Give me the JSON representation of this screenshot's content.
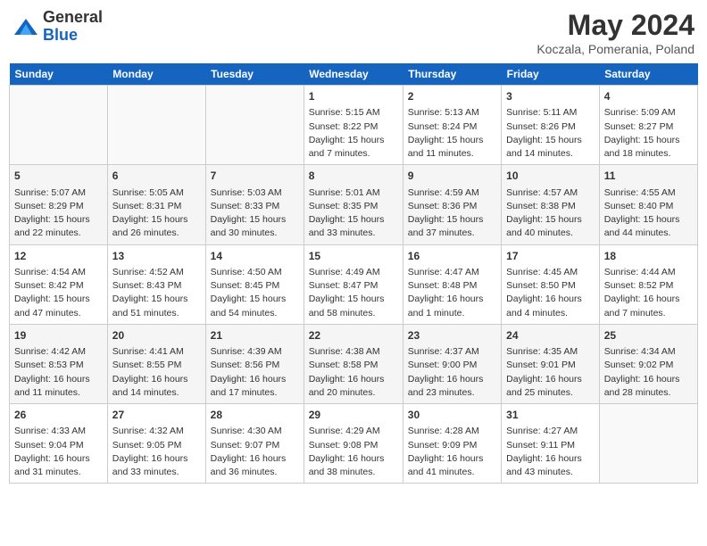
{
  "header": {
    "logo_general": "General",
    "logo_blue": "Blue",
    "month_title": "May 2024",
    "location": "Koczala, Pomerania, Poland"
  },
  "days_of_week": [
    "Sunday",
    "Monday",
    "Tuesday",
    "Wednesday",
    "Thursday",
    "Friday",
    "Saturday"
  ],
  "weeks": [
    [
      {
        "num": "",
        "content": ""
      },
      {
        "num": "",
        "content": ""
      },
      {
        "num": "",
        "content": ""
      },
      {
        "num": "1",
        "content": "Sunrise: 5:15 AM\nSunset: 8:22 PM\nDaylight: 15 hours\nand 7 minutes."
      },
      {
        "num": "2",
        "content": "Sunrise: 5:13 AM\nSunset: 8:24 PM\nDaylight: 15 hours\nand 11 minutes."
      },
      {
        "num": "3",
        "content": "Sunrise: 5:11 AM\nSunset: 8:26 PM\nDaylight: 15 hours\nand 14 minutes."
      },
      {
        "num": "4",
        "content": "Sunrise: 5:09 AM\nSunset: 8:27 PM\nDaylight: 15 hours\nand 18 minutes."
      }
    ],
    [
      {
        "num": "5",
        "content": "Sunrise: 5:07 AM\nSunset: 8:29 PM\nDaylight: 15 hours\nand 22 minutes."
      },
      {
        "num": "6",
        "content": "Sunrise: 5:05 AM\nSunset: 8:31 PM\nDaylight: 15 hours\nand 26 minutes."
      },
      {
        "num": "7",
        "content": "Sunrise: 5:03 AM\nSunset: 8:33 PM\nDaylight: 15 hours\nand 30 minutes."
      },
      {
        "num": "8",
        "content": "Sunrise: 5:01 AM\nSunset: 8:35 PM\nDaylight: 15 hours\nand 33 minutes."
      },
      {
        "num": "9",
        "content": "Sunrise: 4:59 AM\nSunset: 8:36 PM\nDaylight: 15 hours\nand 37 minutes."
      },
      {
        "num": "10",
        "content": "Sunrise: 4:57 AM\nSunset: 8:38 PM\nDaylight: 15 hours\nand 40 minutes."
      },
      {
        "num": "11",
        "content": "Sunrise: 4:55 AM\nSunset: 8:40 PM\nDaylight: 15 hours\nand 44 minutes."
      }
    ],
    [
      {
        "num": "12",
        "content": "Sunrise: 4:54 AM\nSunset: 8:42 PM\nDaylight: 15 hours\nand 47 minutes."
      },
      {
        "num": "13",
        "content": "Sunrise: 4:52 AM\nSunset: 8:43 PM\nDaylight: 15 hours\nand 51 minutes."
      },
      {
        "num": "14",
        "content": "Sunrise: 4:50 AM\nSunset: 8:45 PM\nDaylight: 15 hours\nand 54 minutes."
      },
      {
        "num": "15",
        "content": "Sunrise: 4:49 AM\nSunset: 8:47 PM\nDaylight: 15 hours\nand 58 minutes."
      },
      {
        "num": "16",
        "content": "Sunrise: 4:47 AM\nSunset: 8:48 PM\nDaylight: 16 hours\nand 1 minute."
      },
      {
        "num": "17",
        "content": "Sunrise: 4:45 AM\nSunset: 8:50 PM\nDaylight: 16 hours\nand 4 minutes."
      },
      {
        "num": "18",
        "content": "Sunrise: 4:44 AM\nSunset: 8:52 PM\nDaylight: 16 hours\nand 7 minutes."
      }
    ],
    [
      {
        "num": "19",
        "content": "Sunrise: 4:42 AM\nSunset: 8:53 PM\nDaylight: 16 hours\nand 11 minutes."
      },
      {
        "num": "20",
        "content": "Sunrise: 4:41 AM\nSunset: 8:55 PM\nDaylight: 16 hours\nand 14 minutes."
      },
      {
        "num": "21",
        "content": "Sunrise: 4:39 AM\nSunset: 8:56 PM\nDaylight: 16 hours\nand 17 minutes."
      },
      {
        "num": "22",
        "content": "Sunrise: 4:38 AM\nSunset: 8:58 PM\nDaylight: 16 hours\nand 20 minutes."
      },
      {
        "num": "23",
        "content": "Sunrise: 4:37 AM\nSunset: 9:00 PM\nDaylight: 16 hours\nand 23 minutes."
      },
      {
        "num": "24",
        "content": "Sunrise: 4:35 AM\nSunset: 9:01 PM\nDaylight: 16 hours\nand 25 minutes."
      },
      {
        "num": "25",
        "content": "Sunrise: 4:34 AM\nSunset: 9:02 PM\nDaylight: 16 hours\nand 28 minutes."
      }
    ],
    [
      {
        "num": "26",
        "content": "Sunrise: 4:33 AM\nSunset: 9:04 PM\nDaylight: 16 hours\nand 31 minutes."
      },
      {
        "num": "27",
        "content": "Sunrise: 4:32 AM\nSunset: 9:05 PM\nDaylight: 16 hours\nand 33 minutes."
      },
      {
        "num": "28",
        "content": "Sunrise: 4:30 AM\nSunset: 9:07 PM\nDaylight: 16 hours\nand 36 minutes."
      },
      {
        "num": "29",
        "content": "Sunrise: 4:29 AM\nSunset: 9:08 PM\nDaylight: 16 hours\nand 38 minutes."
      },
      {
        "num": "30",
        "content": "Sunrise: 4:28 AM\nSunset: 9:09 PM\nDaylight: 16 hours\nand 41 minutes."
      },
      {
        "num": "31",
        "content": "Sunrise: 4:27 AM\nSunset: 9:11 PM\nDaylight: 16 hours\nand 43 minutes."
      },
      {
        "num": "",
        "content": ""
      }
    ]
  ]
}
